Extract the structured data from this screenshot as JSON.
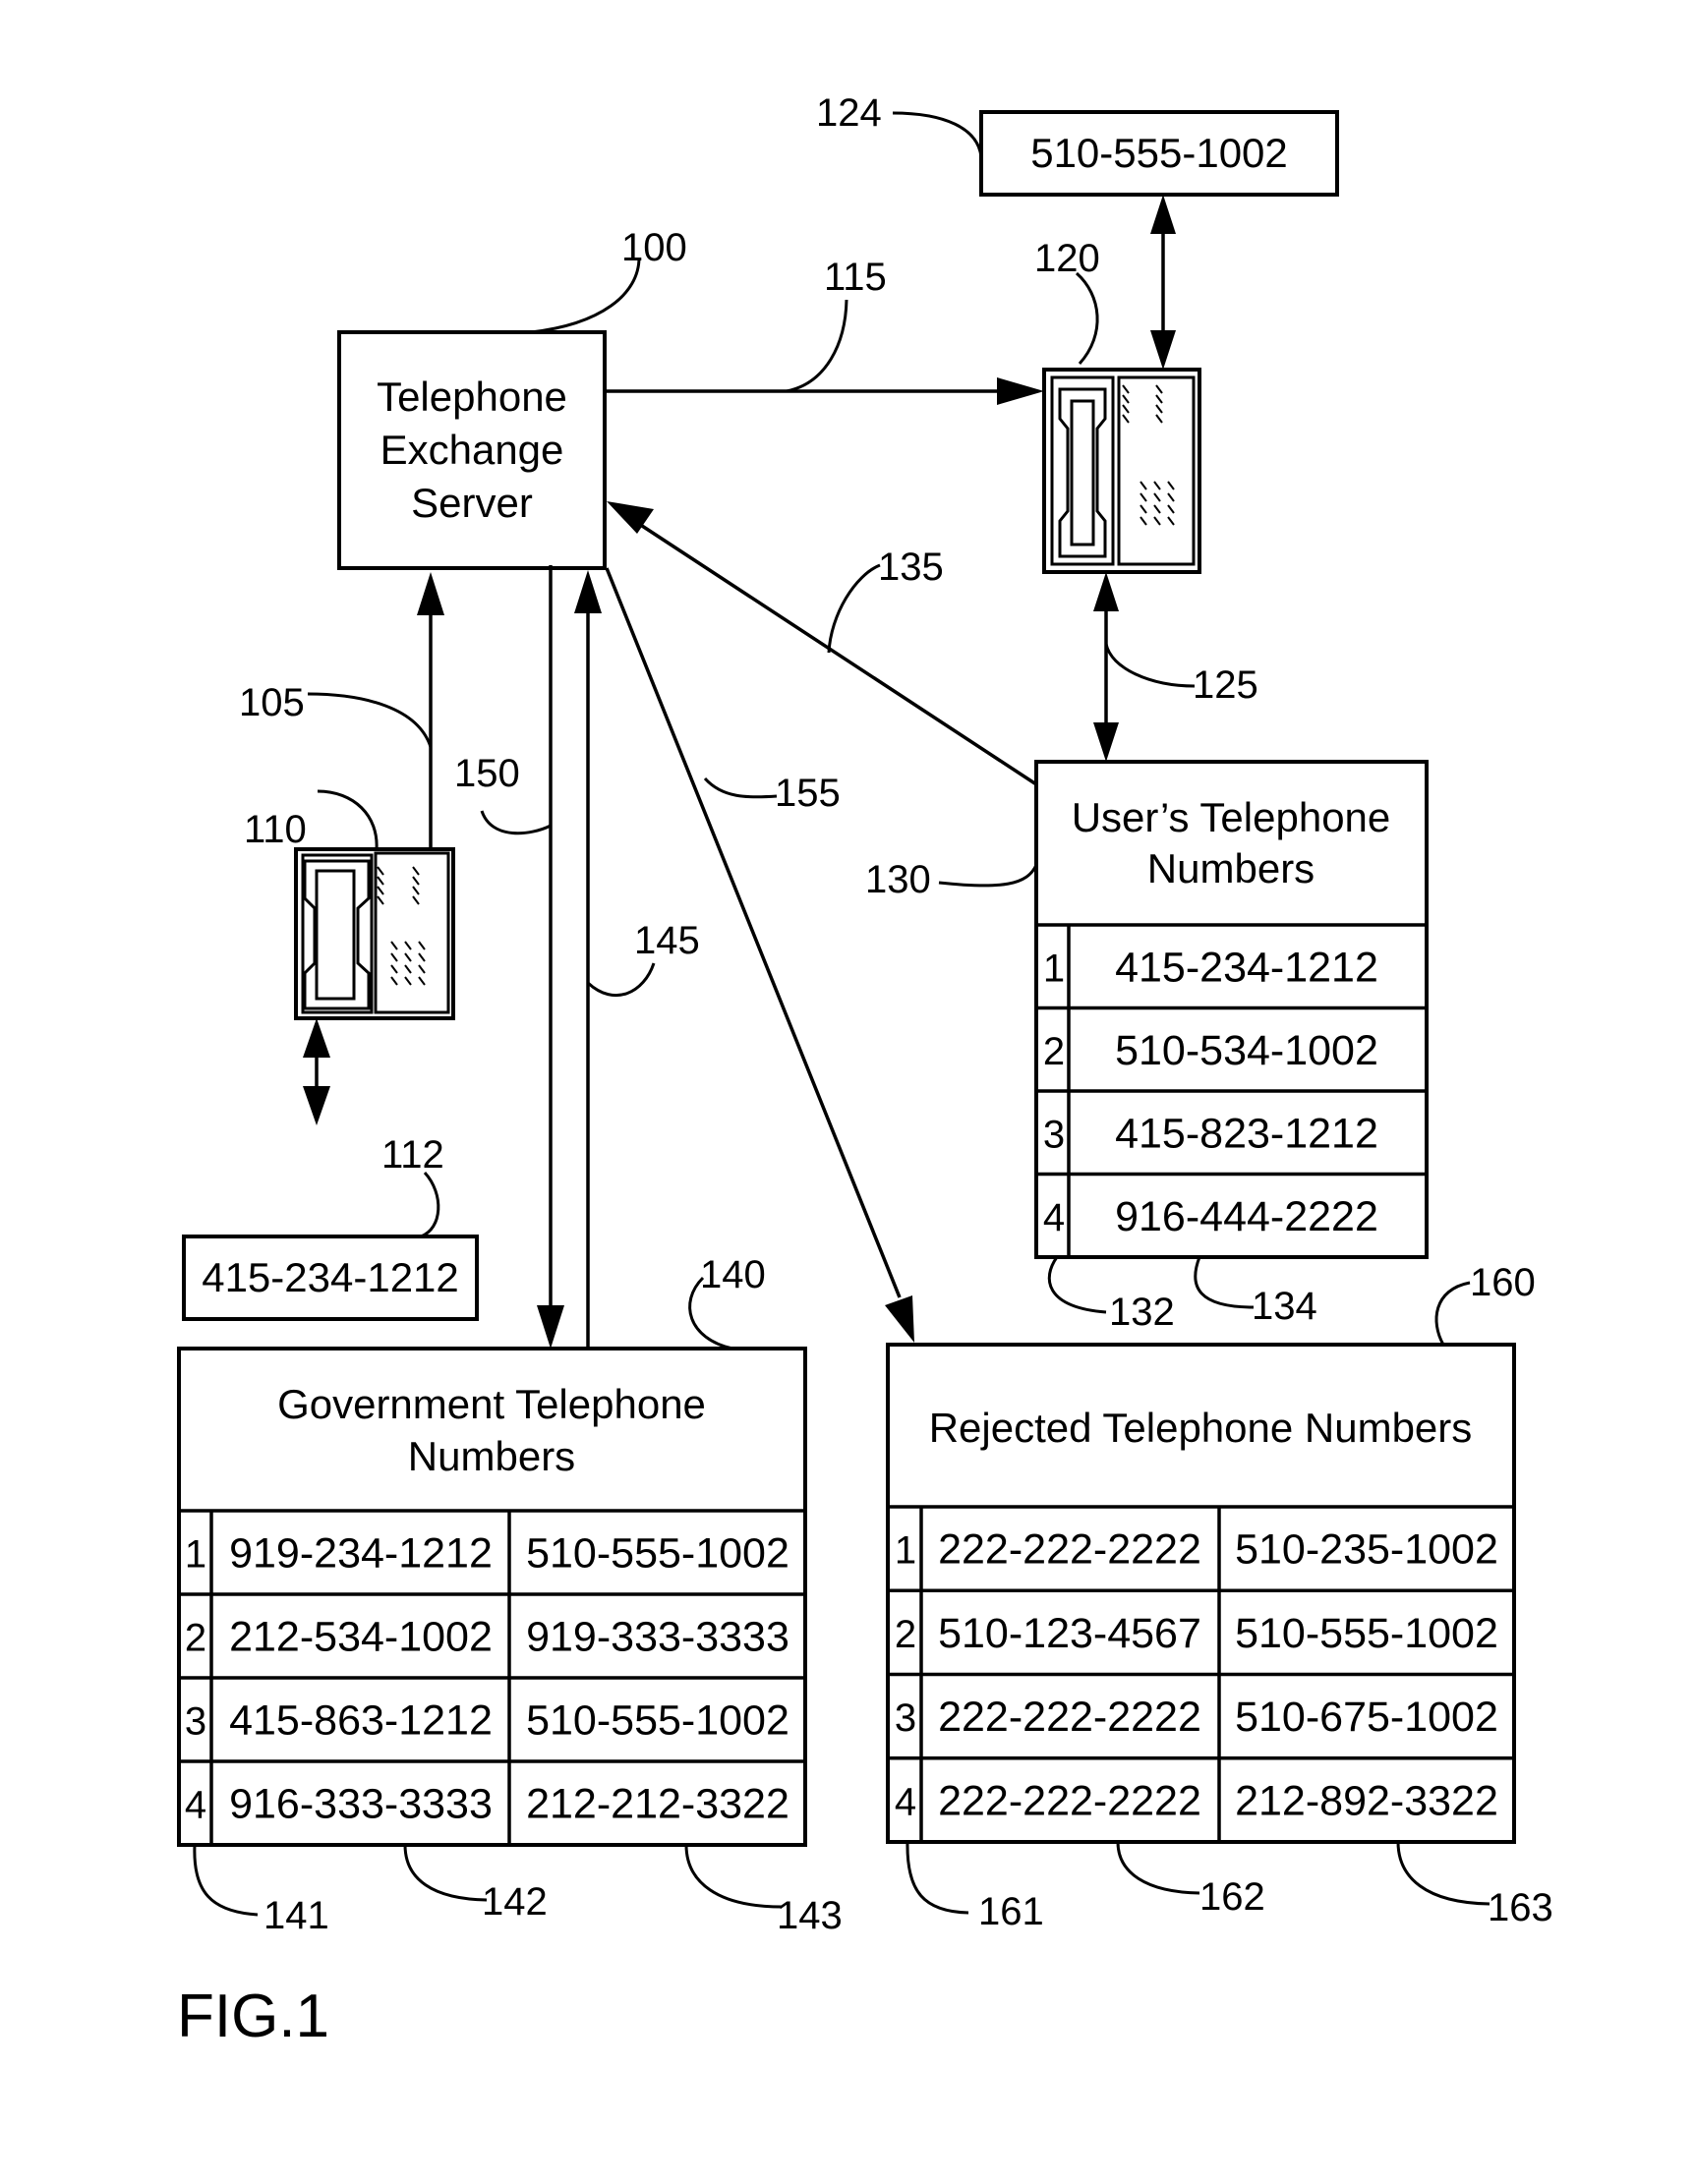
{
  "figure_label": "FIG.1",
  "server": {
    "ref": "100",
    "lines": [
      "Telephone",
      "Exchange",
      "Server"
    ]
  },
  "phone_right": {
    "ref": "120",
    "number_ref": "124",
    "number": "510-555-1002"
  },
  "phone_left": {
    "ref": "110",
    "number_ref": "112",
    "number": "415-234-1212"
  },
  "connections": {
    "c105": "105",
    "c115": "115",
    "c125": "125",
    "c135": "135",
    "c145": "145",
    "c150": "150",
    "c155": "155"
  },
  "users_table": {
    "ref": "130",
    "title_lines": [
      "User’s Telephone",
      "Numbers"
    ],
    "index_col_ref": "132",
    "number_col_ref": "134",
    "rows": [
      {
        "index": "1",
        "number": "415-234-1212"
      },
      {
        "index": "2",
        "number": "510-534-1002"
      },
      {
        "index": "3",
        "number": "415-823-1212"
      },
      {
        "index": "4",
        "number": "916-444-2222"
      }
    ]
  },
  "government_table": {
    "ref": "140",
    "title_lines": [
      "Government Telephone",
      "Numbers"
    ],
    "col_refs": [
      "141",
      "142",
      "143"
    ],
    "rows": [
      {
        "index": "1",
        "a": "919-234-1212",
        "b": "510-555-1002"
      },
      {
        "index": "2",
        "a": "212-534-1002",
        "b": "919-333-3333"
      },
      {
        "index": "3",
        "a": "415-863-1212",
        "b": "510-555-1002"
      },
      {
        "index": "4",
        "a": "916-333-3333",
        "b": "212-212-3322"
      }
    ]
  },
  "rejected_table": {
    "ref": "160",
    "title": "Rejected Telephone  Numbers",
    "col_refs": [
      "161",
      "162",
      "163"
    ],
    "rows": [
      {
        "index": "1",
        "a": "222-222-2222",
        "b": "510-235-1002"
      },
      {
        "index": "2",
        "a": "510-123-4567",
        "b": "510-555-1002"
      },
      {
        "index": "3",
        "a": "222-222-2222",
        "b": "510-675-1002"
      },
      {
        "index": "4",
        "a": "222-222-2222",
        "b": "212-892-3322"
      }
    ]
  }
}
